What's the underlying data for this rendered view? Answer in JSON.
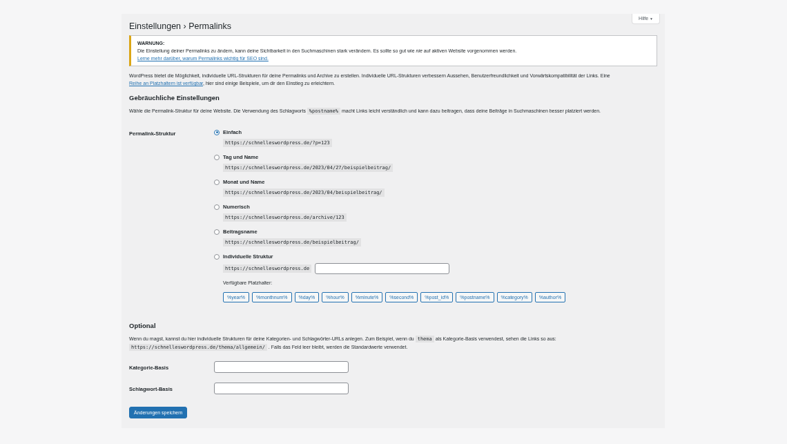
{
  "help_button": {
    "label": "Hilfe",
    "caret": "▼"
  },
  "title": "Einstellungen › Permalinks",
  "warning": {
    "heading": "WARNUNG:",
    "text": "Die Einstellung deiner Permalinks zu ändern, kann deine Sichtbarkeit in den Suchmaschinen stark verändern. Es sollte so gut wie *nie* auf aktiven Website vorgenommen werden.",
    "link": "Lerne mehr darüber, warum Permalinks wichtig für SEO sind."
  },
  "intro": [
    {
      "kind": "text",
      "text": "WordPress bietet die Möglichkeit, individuelle URL-Strukturen für deine Permalinks und Archive zu erstellen. Individuelle URL-Strukturen verbessern Aussehen, Benutzerfreundlichkeit und Vorwärtskompatibilität der Links. Eine "
    },
    {
      "kind": "link",
      "text": "Reihe an Platzhaltern ist verfügbar"
    },
    {
      "kind": "text",
      "text": ", hier sind einige Beispiele, um dir den Einstieg zu erleichtern."
    }
  ],
  "common_heading": "Gebräuchliche Einstellungen",
  "common_text": [
    {
      "kind": "text",
      "text": "Wähle die Permalink-Struktur für deine Website. Die Verwendung des Schlagworts "
    },
    {
      "kind": "code",
      "text": "%postname%"
    },
    {
      "kind": "text",
      "text": " macht Links leicht verständlich und kann dazu beitragen, dass deine Beiträge in Suchmaschinen besser platziert werden."
    }
  ],
  "structure_label": "Permalink-Struktur",
  "options": [
    {
      "label": "Einfach",
      "example": "https://schnelleswordpress.de/?p=123",
      "selected": true
    },
    {
      "label": "Tag und Name",
      "example": "https://schnelleswordpress.de/2023/04/27/beispielbeitrag/",
      "selected": false
    },
    {
      "label": "Monat und Name",
      "example": "https://schnelleswordpress.de/2023/04/beispielbeitrag/",
      "selected": false
    },
    {
      "label": "Numerisch",
      "example": "https://schnelleswordpress.de/archive/123",
      "selected": false
    },
    {
      "label": "Beitragsname",
      "example": "https://schnelleswordpress.de/beispielbeitrag/",
      "selected": false
    }
  ],
  "custom": {
    "label": "Individuelle Struktur",
    "selected": false,
    "prefix": "https://schnelleswordpress.de",
    "tags_label": "Verfügbare Platzhalter:",
    "tags": [
      "%year%",
      "%monthnum%",
      "%day%",
      "%hour%",
      "%minute%",
      "%second%",
      "%post_id%",
      "%postname%",
      "%category%",
      "%author%"
    ]
  },
  "optional_heading": "Optional",
  "optional_text": [
    {
      "kind": "text",
      "text": "Wenn du magst, kannst du hier individuelle Strukturen für deine Kategorien- und Schlagwörter-URLs anlegen. Zum Beispiel, wenn du "
    },
    {
      "kind": "code",
      "text": "thema"
    },
    {
      "kind": "text",
      "text": " als Kategorie-Basis verwendest, sehen die Links so aus: "
    },
    {
      "kind": "code",
      "text": "https://schnelleswordpress.de/thema/allgemein/"
    },
    {
      "kind": "text",
      "text": " . Falls das Feld leer bleibt, werden die Standardwerte verwendet."
    }
  ],
  "fields": [
    {
      "label": "Kategorie-Basis"
    },
    {
      "label": "Schlagwort-Basis"
    }
  ],
  "save_button": "Änderungen speichern"
}
